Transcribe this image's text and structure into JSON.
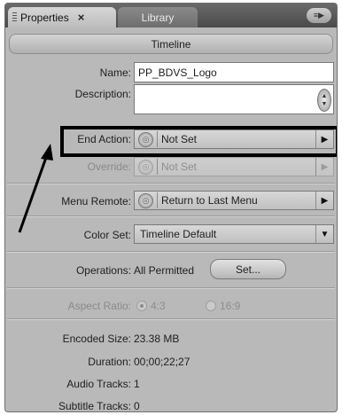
{
  "tabs": {
    "active": "Properties",
    "active_close": "×",
    "inactive": "Library"
  },
  "panel_menu_icon": "panel-menu-icon",
  "title": "Timeline",
  "name": {
    "label": "Name:",
    "value": "PP_BDVS_Logo"
  },
  "description": {
    "label": "Description:",
    "value": ""
  },
  "end_action": {
    "label": "End Action:",
    "value": "Not Set"
  },
  "override": {
    "label": "Override:",
    "value": "Not Set"
  },
  "menu_remote": {
    "label": "Menu Remote:",
    "value": "Return to Last Menu"
  },
  "color_set": {
    "label": "Color Set:",
    "value": "Timeline Default"
  },
  "operations": {
    "label": "Operations:",
    "value": "All Permitted",
    "button": "Set..."
  },
  "aspect_ratio": {
    "label": "Aspect Ratio:",
    "option_1": "4:3",
    "option_2": "16:9"
  },
  "encoded_size": {
    "label": "Encoded Size:",
    "value": "23.38 MB"
  },
  "duration": {
    "label": "Duration:",
    "value": "00;00;22;27"
  },
  "audio_tracks": {
    "label": "Audio Tracks:",
    "value": "1"
  },
  "subtitle_tracks": {
    "label": "Subtitle Tracks:",
    "value": "0"
  },
  "colors": {
    "highlight": "#000000",
    "panel": "#b9b9b9",
    "field": "#ffffff"
  }
}
